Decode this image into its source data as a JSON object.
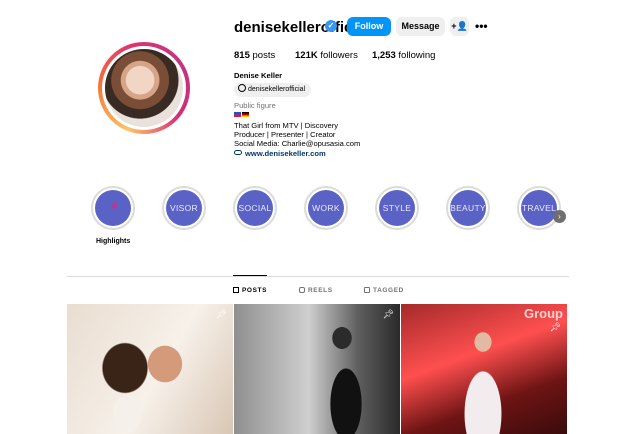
{
  "profile": {
    "username": "denisekellerofficial",
    "verified_mark": "✓",
    "full_name": "Denise Keller",
    "threads_handle": "denisekellerofficial",
    "category": "Public figure",
    "bio_lines": [
      "That Girl from MTV | Discovery",
      "Producer | Presenter | Creator",
      "Social Media: Charlie@opusasia.com"
    ],
    "link": "www.denisekeller.com"
  },
  "actions": {
    "follow": "Follow",
    "message": "Message",
    "add_user_icon": "add-user-icon",
    "more": "•••"
  },
  "stats": {
    "posts": {
      "value": "815",
      "label": " posts"
    },
    "followers": {
      "value": "121K",
      "label": " followers"
    },
    "following": {
      "value": "1,253",
      "label": " following"
    }
  },
  "highlights": {
    "items": [
      {
        "label": "",
        "icon": "pin-icon"
      },
      {
        "label": "VISOR"
      },
      {
        "label": "SOCIAL"
      },
      {
        "label": "WORK"
      },
      {
        "label": "STYLE"
      },
      {
        "label": "BEAUTY"
      },
      {
        "label": "TRAVEL"
      }
    ],
    "first_caption": "Highlights",
    "next_icon": "chevron-right-icon"
  },
  "tabs": [
    {
      "label": "POSTS",
      "active": true
    },
    {
      "label": "REELS",
      "active": false
    },
    {
      "label": "TAGGED",
      "active": false
    }
  ],
  "posts": [
    {
      "pinned": true
    },
    {
      "pinned": true
    },
    {
      "pinned": true,
      "overlay_text": "Group"
    }
  ],
  "colors": {
    "accent": "#0095f6",
    "highlight_fill": "#5b62c6",
    "link": "#00376b"
  }
}
